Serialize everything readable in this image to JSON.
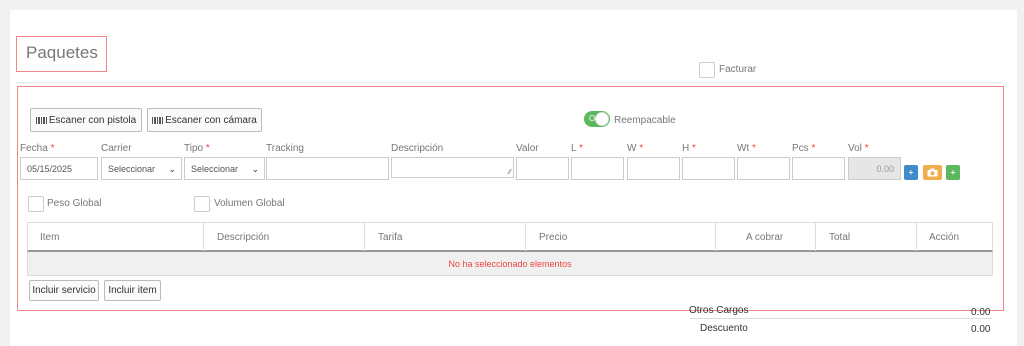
{
  "section": {
    "title": "Paquetes",
    "facturar_label": "Facturar"
  },
  "toolbar": {
    "scan_gun": "Escaner con pistola",
    "scan_camera": "Escaner con cámara",
    "toggle_state": "On",
    "toggle_label": "Reempacable"
  },
  "fields": {
    "fecha": {
      "label": "Fecha",
      "value": "05/15/2025"
    },
    "carrier": {
      "label": "Carrier",
      "value": "Seleccionar"
    },
    "tipo": {
      "label": "Tipo",
      "value": "Seleccionar"
    },
    "tracking": {
      "label": "Tracking",
      "value": ""
    },
    "descripcion": {
      "label": "Descripción",
      "value": ""
    },
    "valor": {
      "label": "Valor",
      "value": ""
    },
    "l": {
      "label": "L",
      "value": ""
    },
    "w": {
      "label": "W",
      "value": ""
    },
    "h": {
      "label": "H",
      "value": ""
    },
    "wt": {
      "label": "Wt",
      "value": ""
    },
    "pcs": {
      "label": "Pcs",
      "value": ""
    },
    "vol": {
      "label": "Vol",
      "value": "0.00"
    },
    "required_mark": "*"
  },
  "actions": {
    "add": "+",
    "camera_icon": "camera-icon",
    "confirm": "+"
  },
  "options": {
    "peso_global": "Peso Global",
    "volumen_global": "Volumen Global"
  },
  "table": {
    "columns": [
      "Item",
      "Descripción",
      "Tarifa",
      "Precio",
      "A cobrar",
      "Total",
      "Acción"
    ],
    "empty_message": "No ha seleccionado elementos"
  },
  "buttons": {
    "incluir_servicio": "Incluir servicio",
    "incluir_item": "Incluir item"
  },
  "summary": {
    "otros_cargos_label": "Otros Cargos",
    "otros_cargos_value": "0.00",
    "descuento_label": "Descuento",
    "descuento_value": "0.00"
  },
  "colors": {
    "accent_red": "#e88888",
    "toggle_green": "#5cb85c",
    "blue": "#428bca",
    "orange": "#f0ad4e",
    "green": "#5cb85c"
  }
}
